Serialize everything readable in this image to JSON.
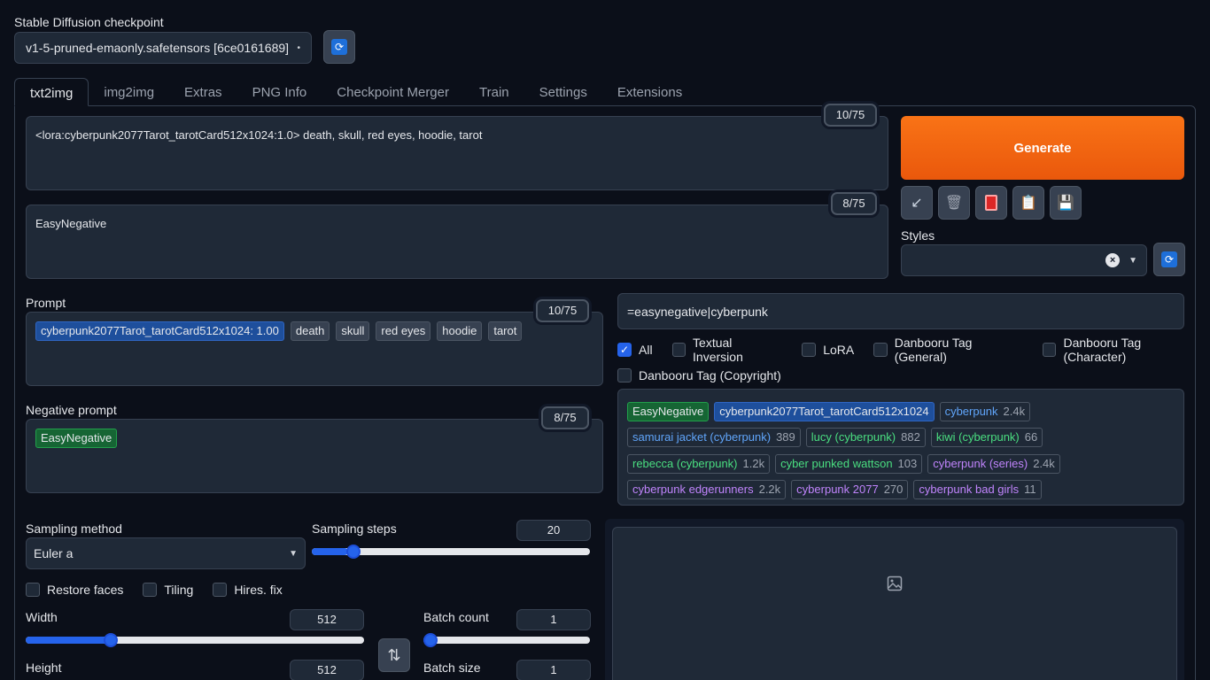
{
  "checkpoint": {
    "label": "Stable Diffusion checkpoint",
    "value": "v1-5-pruned-emaonly.safetensors [6ce0161689]"
  },
  "tabs": [
    "txt2img",
    "img2img",
    "Extras",
    "PNG Info",
    "Checkpoint Merger",
    "Train",
    "Settings",
    "Extensions"
  ],
  "prompt_box": {
    "text": "<lora:cyberpunk2077Tarot_tarotCard512x1024:1.0> death, skull, red eyes, hoodie, tarot",
    "counter": "10/75"
  },
  "negative_box": {
    "text": "EasyNegative",
    "counter": "8/75"
  },
  "generate_label": "Generate",
  "styles_label": "Styles",
  "prompt_tags": {
    "label": "Prompt",
    "counter": "10/75",
    "chips": [
      {
        "text": "cyberpunk2077Tarot_tarotCard512x1024: 1.00",
        "color": "#1e4f9c"
      },
      {
        "text": "death"
      },
      {
        "text": "skull"
      },
      {
        "text": "red eyes"
      },
      {
        "text": "hoodie"
      },
      {
        "text": "tarot"
      }
    ]
  },
  "negative_tags": {
    "label": "Negative prompt",
    "counter": "8/75",
    "chips": [
      {
        "text": "EasyNegative",
        "color": "#166534"
      }
    ]
  },
  "search": {
    "value": "=easynegative|cyberpunk",
    "filters": [
      {
        "label": "All",
        "checked": true
      },
      {
        "label": "Textual Inversion",
        "checked": false
      },
      {
        "label": "LoRA",
        "checked": false
      },
      {
        "label": "Danbooru Tag (General)",
        "checked": false
      },
      {
        "label": "Danbooru Tag (Character)",
        "checked": false
      },
      {
        "label": "Danbooru Tag (Copyright)",
        "checked": false
      }
    ],
    "results": [
      [
        {
          "name": "EasyNegative",
          "count": "",
          "color": "#4ade80",
          "bg": "#166534"
        },
        {
          "name": "cyberpunk2077Tarot_tarotCard512x1024",
          "count": "",
          "color": "#e5e7eb",
          "bg": "#1e4f9c"
        },
        {
          "name": "cyberpunk",
          "count": "2.4k",
          "color": "#60a5fa",
          "bg": ""
        }
      ],
      [
        {
          "name": "samurai jacket (cyberpunk)",
          "count": "389",
          "color": "#60a5fa",
          "bg": ""
        },
        {
          "name": "lucy (cyberpunk)",
          "count": "882",
          "color": "#4ade80",
          "bg": ""
        },
        {
          "name": "kiwi (cyberpunk)",
          "count": "66",
          "color": "#4ade80",
          "bg": ""
        }
      ],
      [
        {
          "name": "rebecca (cyberpunk)",
          "count": "1.2k",
          "color": "#4ade80",
          "bg": ""
        },
        {
          "name": "cyber punked wattson",
          "count": "103",
          "color": "#4ade80",
          "bg": ""
        },
        {
          "name": "cyberpunk (series)",
          "count": "2.4k",
          "color": "#c084fc",
          "bg": ""
        }
      ],
      [
        {
          "name": "cyberpunk edgerunners",
          "count": "2.2k",
          "color": "#c084fc",
          "bg": ""
        },
        {
          "name": "cyberpunk 2077",
          "count": "270",
          "color": "#c084fc",
          "bg": ""
        },
        {
          "name": "cyberpunk bad girls",
          "count": "11",
          "color": "#c084fc",
          "bg": ""
        }
      ]
    ]
  },
  "sampling": {
    "method_label": "Sampling method",
    "method_value": "Euler a",
    "steps_label": "Sampling steps",
    "steps_value": "20",
    "steps_fraction": 0.13
  },
  "options": [
    {
      "label": "Restore faces",
      "checked": false
    },
    {
      "label": "Tiling",
      "checked": false
    },
    {
      "label": "Hires. fix",
      "checked": false
    }
  ],
  "width": {
    "label": "Width",
    "value": "512",
    "fraction": 0.24
  },
  "height": {
    "label": "Height",
    "value": "512"
  },
  "batch_count": {
    "label": "Batch count",
    "value": "1",
    "fraction": 0.0
  },
  "batch_size": {
    "label": "Batch size",
    "value": "1"
  },
  "swap_icon": "⇅"
}
